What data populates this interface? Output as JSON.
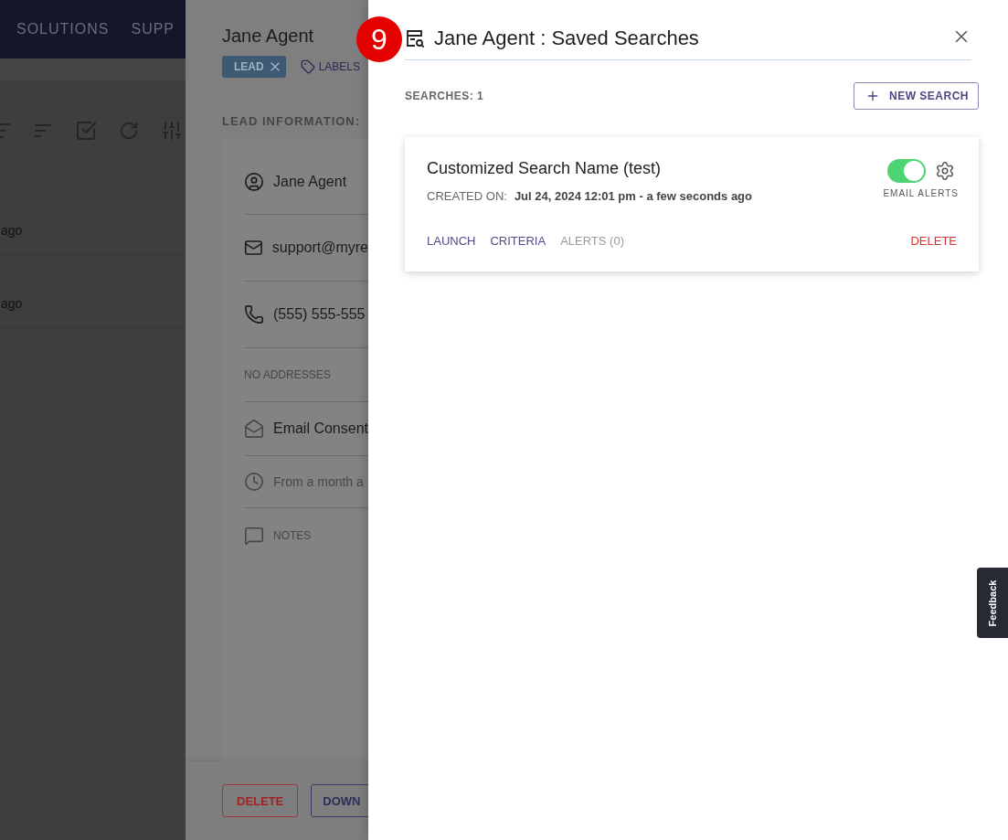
{
  "background_app": {
    "nav_items": [
      "SOLUTIONS",
      "SUPP"
    ],
    "rows": [
      {
        "time": "ago"
      },
      {
        "time": "ago"
      }
    ]
  },
  "lead_panel": {
    "title": "Jane Agent",
    "tags": [
      {
        "label": "LEAD"
      }
    ],
    "labels_button": "LABELS",
    "section_title": "LEAD INFORMATION:",
    "fields": [
      {
        "kind": "person",
        "text": "Jane Agent"
      },
      {
        "kind": "email",
        "text": "support@myre"
      },
      {
        "kind": "phone",
        "text": "(555) 555-555"
      },
      {
        "kind": "empty",
        "text": "NO ADDRESSES"
      },
      {
        "kind": "consent",
        "text": "Email Consent"
      },
      {
        "kind": "history",
        "text": "From a month a"
      },
      {
        "kind": "notes",
        "text": "NOTES"
      }
    ],
    "buttons": [
      {
        "label": "DELETE",
        "kind": "danger"
      },
      {
        "label": "DOWN",
        "kind": "default"
      }
    ]
  },
  "saved_searches": {
    "title": "Jane Agent : Saved Searches",
    "count": "SEARCHES: 1",
    "new_button": "NEW SEARCH",
    "searches": [
      {
        "name": "Customized Search Name (test)",
        "created_label": "CREATED ON:",
        "created_value": "Jul 24, 2024 12:01 pm - a few seconds ago",
        "email_alerts": true,
        "email_alerts_label": "EMAIL ALERTS",
        "actions": [
          {
            "label": "LAUNCH",
            "disabled": false
          },
          {
            "label": "CRITERIA",
            "disabled": false
          },
          {
            "label": "ALERTS (0)",
            "disabled": true
          }
        ],
        "delete_label": "DELETE"
      }
    ]
  },
  "step_badge": "9",
  "feedback_tab": "Feedback"
}
